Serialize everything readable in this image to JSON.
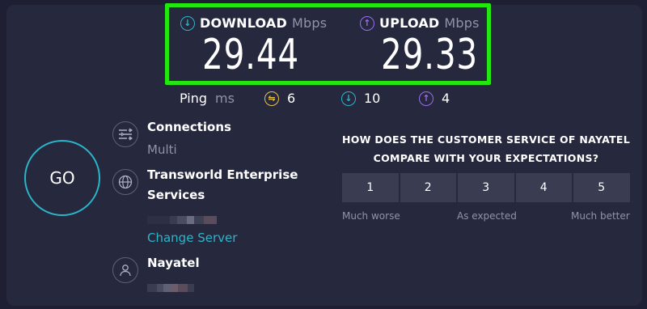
{
  "results": {
    "download": {
      "label": "DOWNLOAD",
      "unit": "Mbps",
      "value": "29.44",
      "icon": "download-arrow-icon",
      "color": "#2bb5c8"
    },
    "upload": {
      "label": "UPLOAD",
      "unit": "Mbps",
      "value": "29.33",
      "icon": "upload-arrow-icon",
      "color": "#9b6cf0"
    }
  },
  "ping": {
    "label": "Ping",
    "unit": "ms",
    "idle": {
      "value": "6",
      "icon": "ping-idle-icon",
      "color": "#e8c24a"
    },
    "download": {
      "value": "10",
      "icon": "ping-download-icon",
      "color": "#2bb5c8"
    },
    "upload": {
      "value": "4",
      "icon": "ping-upload-icon",
      "color": "#9b6cf0"
    }
  },
  "go_button": {
    "label": "GO"
  },
  "connections": {
    "title": "Connections",
    "value": "Multi",
    "icon": "connections-icon"
  },
  "server": {
    "title_line1": "Transworld Enterprise",
    "title_line2": "Services",
    "change_label": "Change Server",
    "icon": "globe-icon"
  },
  "provider": {
    "title": "Nayatel",
    "icon": "user-icon"
  },
  "survey": {
    "question_line1": "HOW DOES THE CUSTOMER SERVICE OF NAYATEL",
    "question_line2": "COMPARE WITH YOUR EXPECTATIONS?",
    "options": [
      "1",
      "2",
      "3",
      "4",
      "5"
    ],
    "scale_low": "Much worse",
    "scale_mid": "As expected",
    "scale_high": "Much better"
  },
  "colors": {
    "highlight": "#22e80f",
    "accent": "#2bb5c8",
    "background": "#1e1f33"
  }
}
